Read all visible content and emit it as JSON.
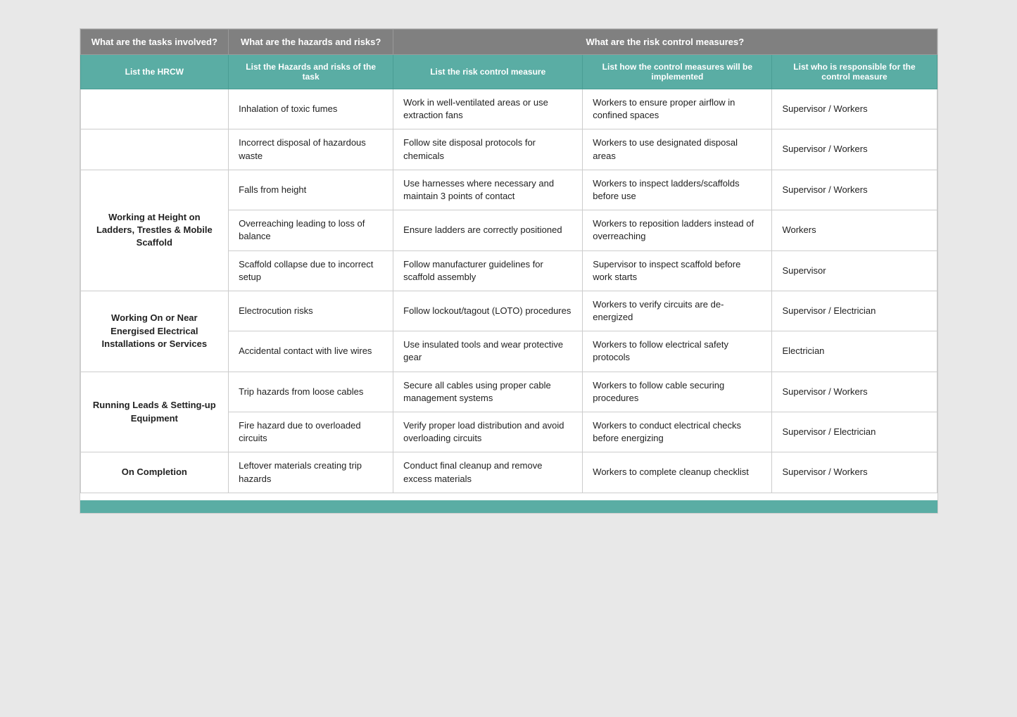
{
  "headers1": {
    "col1": "What are the tasks involved?",
    "col2": "What are the hazards and risks?",
    "col3": "What are the risk control measures?"
  },
  "headers2": {
    "col1": "List the HRCW",
    "col2": "List the Hazards and risks of the task",
    "col3": "List the risk control measure",
    "col4": "List how the control measures will be implemented",
    "col5": "List who is responsible for the control measure"
  },
  "rows": [
    {
      "task": "",
      "task_rowspan": 0,
      "hazard": "Inhalation of toxic fumes",
      "measure": "Work in well-ventilated areas or use extraction fans",
      "implement": "Workers to ensure proper airflow in confined spaces",
      "responsible": "Supervisor / Workers"
    },
    {
      "task": "",
      "task_rowspan": 0,
      "hazard": "Incorrect disposal of hazardous waste",
      "measure": "Follow site disposal protocols for chemicals",
      "implement": "Workers to use designated disposal areas",
      "responsible": "Supervisor / Workers"
    },
    {
      "task": "Working at Height on Ladders, Trestles & Mobile Scaffold",
      "task_rowspan": 3,
      "hazard": "Falls from height",
      "measure": "Use harnesses where necessary and maintain 3 points of contact",
      "implement": "Workers to inspect ladders/scaffolds before use",
      "responsible": "Supervisor / Workers"
    },
    {
      "task": null,
      "hazard": "Overreaching leading to loss of balance",
      "measure": "Ensure ladders are correctly positioned",
      "implement": "Workers to reposition ladders instead of overreaching",
      "responsible": "Workers"
    },
    {
      "task": null,
      "hazard": "Scaffold collapse due to incorrect setup",
      "measure": "Follow manufacturer guidelines for scaffold assembly",
      "implement": "Supervisor to inspect scaffold before work starts",
      "responsible": "Supervisor"
    },
    {
      "task": "Working On or Near Energised Electrical Installations or Services",
      "task_rowspan": 2,
      "hazard": "Electrocution risks",
      "measure": "Follow lockout/tagout (LOTO) procedures",
      "implement": "Workers to verify circuits are de-energized",
      "responsible": "Supervisor / Electrician"
    },
    {
      "task": null,
      "hazard": "Accidental contact with live wires",
      "measure": "Use insulated tools and wear protective gear",
      "implement": "Workers to follow electrical safety protocols",
      "responsible": "Electrician"
    },
    {
      "task": "Running Leads & Setting-up Equipment",
      "task_rowspan": 2,
      "hazard": "Trip hazards from loose cables",
      "measure": "Secure all cables using proper cable management systems",
      "implement": "Workers to follow cable securing procedures",
      "responsible": "Supervisor / Workers"
    },
    {
      "task": null,
      "hazard": "Fire hazard due to overloaded circuits",
      "measure": "Verify proper load distribution and avoid overloading circuits",
      "implement": "Workers to conduct electrical checks before energizing",
      "responsible": "Supervisor / Electrician"
    },
    {
      "task": "On Completion",
      "task_rowspan": 1,
      "hazard": "Leftover materials creating trip hazards",
      "measure": "Conduct final cleanup and remove excess materials",
      "implement": "Workers to complete cleanup checklist",
      "responsible": "Supervisor / Workers"
    }
  ]
}
